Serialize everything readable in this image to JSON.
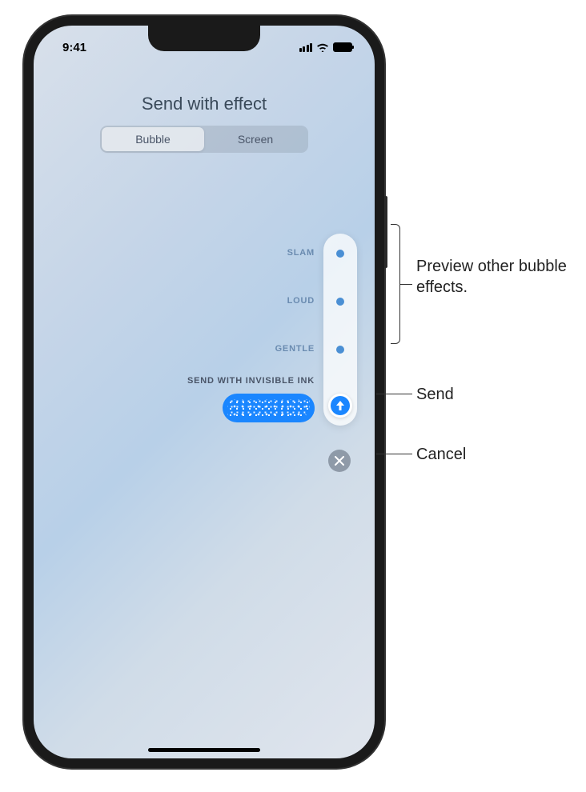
{
  "status_bar": {
    "time": "9:41"
  },
  "page": {
    "title": "Send with effect"
  },
  "tabs": {
    "bubble": "Bubble",
    "screen": "Screen"
  },
  "effects": {
    "slam": "SLAM",
    "loud": "LOUD",
    "gentle": "GENTLE",
    "invisible_ink": "SEND WITH INVISIBLE INK"
  },
  "callouts": {
    "preview": "Preview other bubble effects.",
    "send": "Send",
    "cancel": "Cancel"
  },
  "colors": {
    "accent": "#1a86ff",
    "dot": "#4a8fd4"
  }
}
